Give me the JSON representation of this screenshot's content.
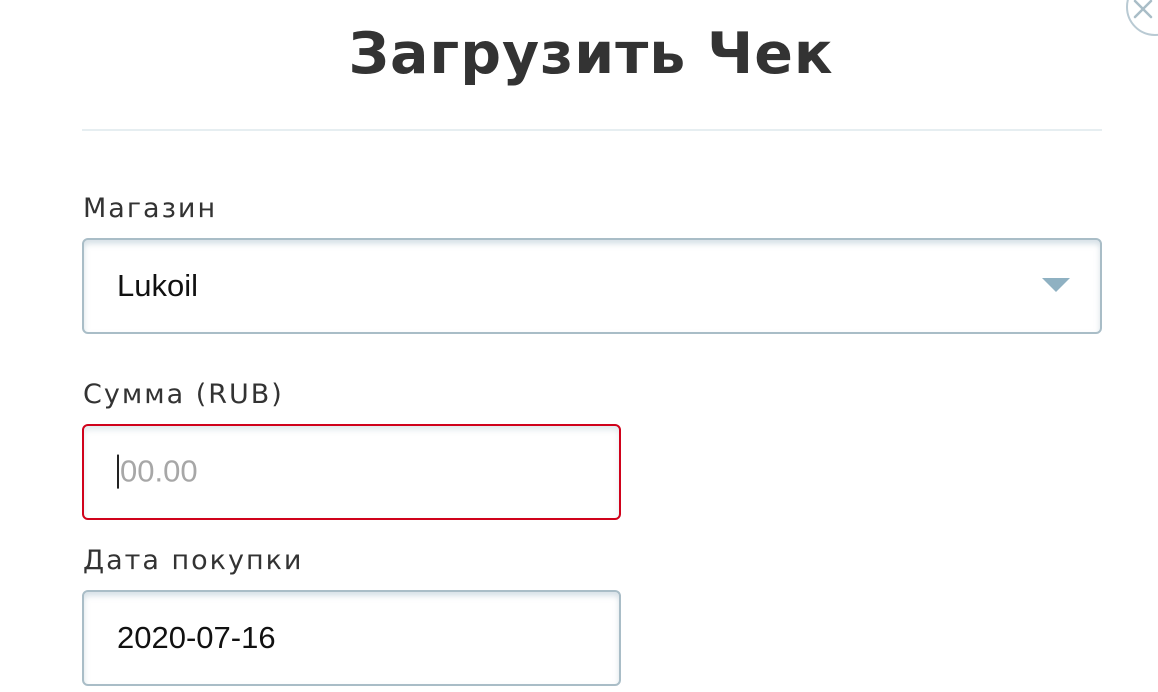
{
  "dialog": {
    "title": "Загрузить Чек"
  },
  "form": {
    "store": {
      "label": "Магазин",
      "selected": "Lukoil"
    },
    "amount": {
      "label": "Сумма (RUB)",
      "value": "",
      "placeholder": "00.00",
      "state": "error"
    },
    "purchase_date": {
      "label": "Дата покупки",
      "value": "2020-07-16"
    }
  },
  "colors": {
    "accent": "#8fb1c2",
    "error_border": "#d0021b",
    "text": "#333333"
  },
  "icons": {
    "close": "close-icon",
    "dropdown": "chevron-down-icon"
  }
}
